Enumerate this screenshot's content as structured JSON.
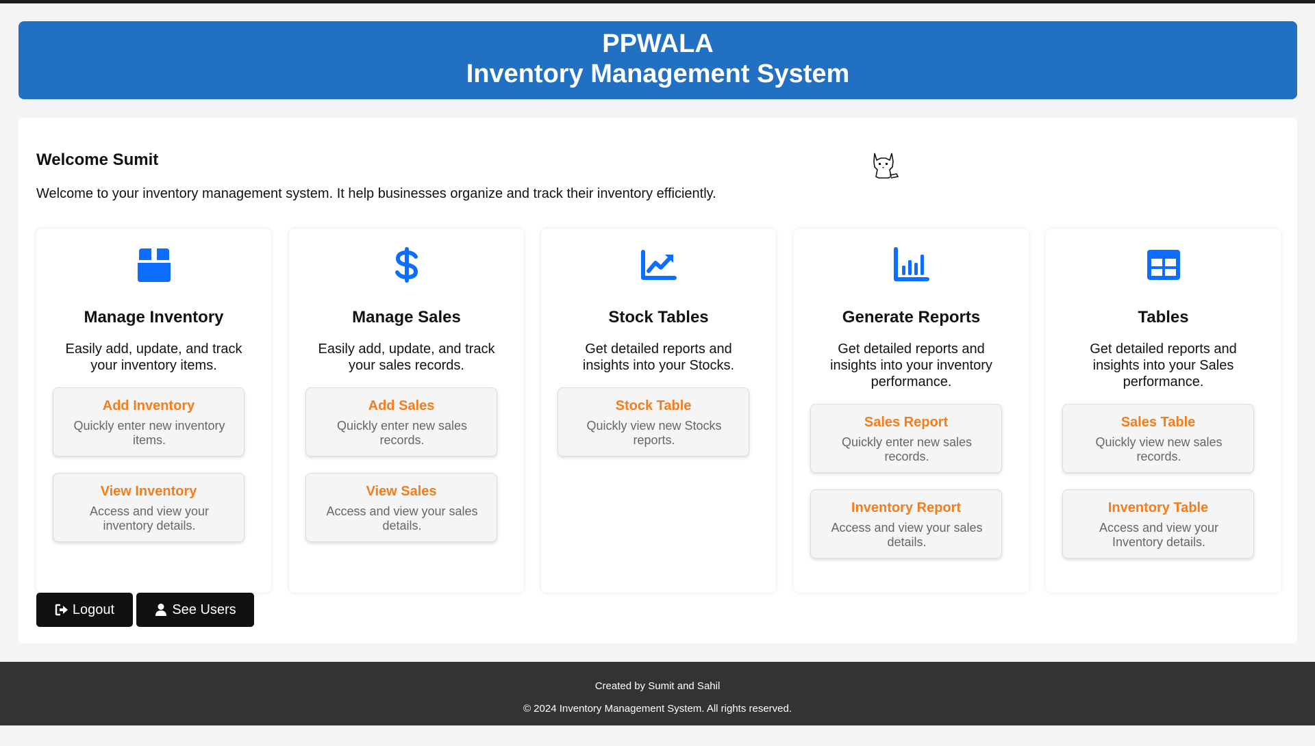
{
  "header": {
    "brand": "PPWALA",
    "title": "Inventory Management System"
  },
  "welcome": {
    "title": "Welcome Sumit",
    "text": "Welcome to your inventory management system. It help businesses organize and track their inventory efficiently."
  },
  "cards": [
    {
      "icon": "box-icon",
      "title": "Manage Inventory",
      "description": "Easily add, update, and track your inventory items.",
      "actions": [
        {
          "title": "Add Inventory",
          "description": "Quickly enter new inventory items."
        },
        {
          "title": "View Inventory",
          "description": "Access and view your inventory details."
        }
      ]
    },
    {
      "icon": "dollar-icon",
      "title": "Manage Sales",
      "description": "Easily add, update, and track your sales records.",
      "actions": [
        {
          "title": "Add Sales",
          "description": "Quickly enter new sales records."
        },
        {
          "title": "View Sales",
          "description": "Access and view your sales details."
        }
      ]
    },
    {
      "icon": "chart-line-icon",
      "title": "Stock Tables",
      "description": "Get detailed reports and insights into your Stocks.",
      "actions": [
        {
          "title": "Stock Table",
          "description": "Quickly view new Stocks reports."
        }
      ]
    },
    {
      "icon": "bar-chart-icon",
      "title": "Generate Reports",
      "description": "Get detailed reports and insights into your inventory performance.",
      "actions": [
        {
          "title": "Sales Report",
          "description": "Quickly enter new sales records."
        },
        {
          "title": "Inventory Report",
          "description": "Access and view your sales details."
        }
      ]
    },
    {
      "icon": "table-icon",
      "title": "Tables",
      "description": "Get detailed reports and insights into your Sales performance.",
      "actions": [
        {
          "title": "Sales Table",
          "description": "Quickly view new sales records."
        },
        {
          "title": "Inventory Table",
          "description": "Access and view your Inventory details."
        }
      ]
    }
  ],
  "buttons": {
    "logout": "Logout",
    "see_users": "See Users"
  },
  "footer": {
    "credits": "Created by Sumit and Sahil",
    "copyright": "© 2024 Inventory Management System. All rights reserved."
  },
  "colors": {
    "header_bg": "#2170c2",
    "icon_blue": "#0d6efd",
    "action_orange": "#f57c1a",
    "footer_bg": "#333333",
    "button_bg": "#111111"
  }
}
